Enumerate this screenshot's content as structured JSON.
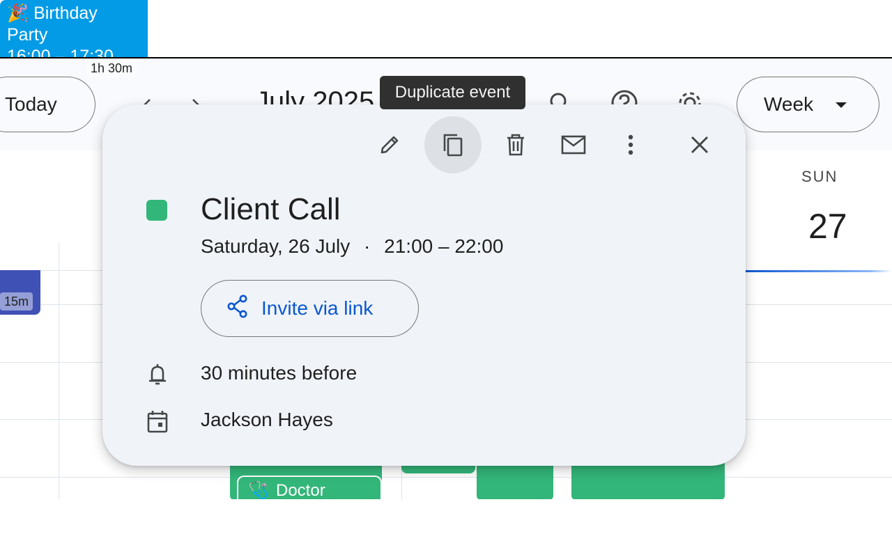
{
  "header": {
    "today_label": "Today",
    "month_title": "July 2025",
    "view_label": "Week"
  },
  "icons": {
    "prev": "chevron-left-icon",
    "next": "chevron-right-icon",
    "search": "search-icon",
    "help": "help-icon",
    "settings": "gear-icon"
  },
  "calendar": {
    "day_name": "SUN",
    "day_number": "27",
    "events": [
      {
        "duration": "15m",
        "color": "#3f51b5"
      },
      {
        "title": "Doctor",
        "emoji": "🩺",
        "color": "#33b679"
      },
      {
        "title": "Birthday Party",
        "emoji": "🎉",
        "time": "16:00 – 17:30",
        "duration": "1h 30m",
        "color": "#039be5"
      }
    ]
  },
  "popup": {
    "tooltip": "Duplicate event",
    "toolbar": [
      "edit-icon",
      "duplicate-icon",
      "delete-icon",
      "email-icon",
      "more-options-icon",
      "close-icon"
    ],
    "event_color": "#33b679",
    "title": "Client Call",
    "date": "Saturday, 26 July",
    "separator": "·",
    "time": "21:00 – 22:00",
    "invite_label": "Invite via link",
    "reminder": "30 minutes before",
    "calendar_owner": "Jackson Hayes"
  },
  "colors": {
    "accent": "#0b57d0",
    "event_green": "#33b679",
    "event_blue": "#039be5",
    "event_indigo": "#3f51b5"
  }
}
